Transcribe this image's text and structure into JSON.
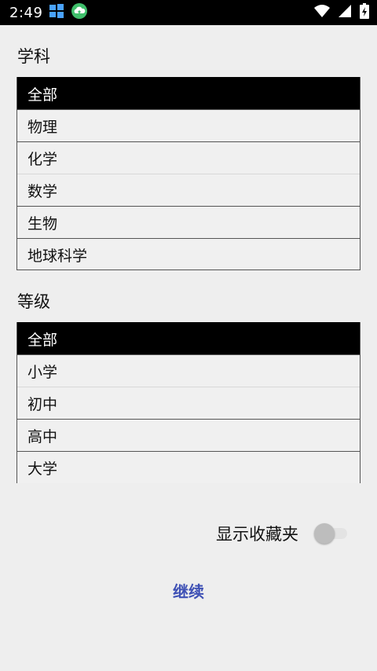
{
  "status_bar": {
    "time": "2:49",
    "icons": [
      "windows-icon",
      "cloud-upload-icon",
      "wifi-icon",
      "signal-icon",
      "battery-icon"
    ]
  },
  "subject": {
    "label": "学科",
    "items": [
      "全部",
      "物理",
      "化学",
      "数学",
      "生物",
      "地球科学"
    ],
    "selected_index": 0
  },
  "level": {
    "label": "等级",
    "items": [
      "全部",
      "小学",
      "初中",
      "高中",
      "大学"
    ],
    "selected_index": 0
  },
  "favorites": {
    "label": "显示收藏夹",
    "enabled": false
  },
  "continue_label": "继续",
  "colors": {
    "accent": "#3f51b5",
    "selected_bg": "#000000",
    "background": "#eeeeee"
  }
}
